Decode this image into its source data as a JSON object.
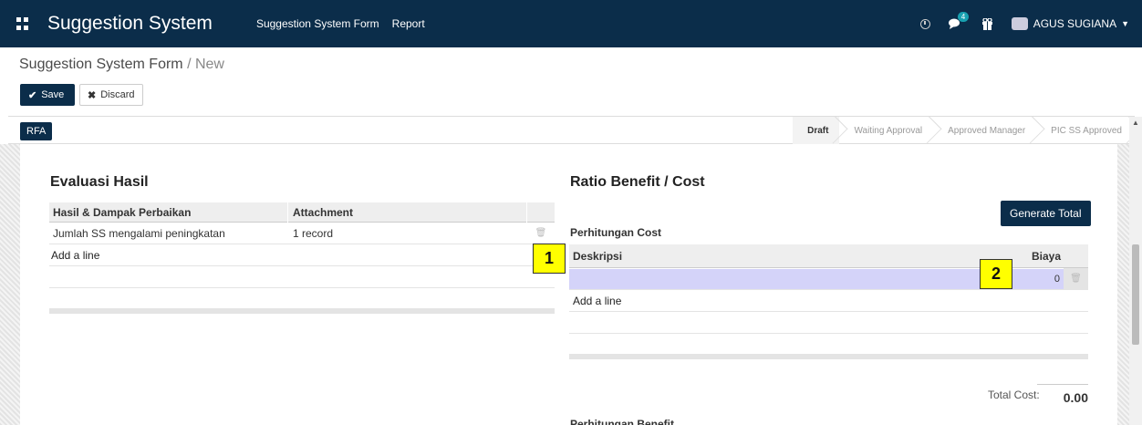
{
  "navbar": {
    "apps_icon": "apps-grid-icon",
    "title": "Suggestion System",
    "links": [
      "Suggestion System Form",
      "Report"
    ],
    "chat_badge": "4",
    "user": "AGUS SUGIANA"
  },
  "breadcrumb": {
    "parent": "Suggestion System Form",
    "separator": " / ",
    "current": "New"
  },
  "buttons": {
    "save": "Save",
    "discard": "Discard",
    "rfa": "RFA",
    "generate_total": "Generate Total"
  },
  "stages": [
    "Draft",
    "Waiting Approval",
    "Approved Manager",
    "PIC SS Approved"
  ],
  "evaluasi": {
    "title": "Evaluasi Hasil",
    "headers": [
      "Hasil & Dampak Perbaikan",
      "Attachment"
    ],
    "rows": [
      [
        "Jumlah SS mengalami peningkatan",
        "1 record"
      ]
    ],
    "add_line": "Add a line"
  },
  "ratio": {
    "title": "Ratio Benefit / Cost",
    "cost_title": "Perhitungan Cost",
    "headers": [
      "Deskripsi",
      "Biaya"
    ],
    "edit_value": "0",
    "add_line": "Add a line",
    "total_label": "Total Cost:",
    "total_value": "0.00",
    "benefit_title": "Perhitungan Benefit"
  },
  "callouts": [
    "1",
    "2"
  ],
  "colors": {
    "navbar": "#0b2d4a",
    "edit_row": "#d4d3f9",
    "callout": "#ffff00"
  }
}
